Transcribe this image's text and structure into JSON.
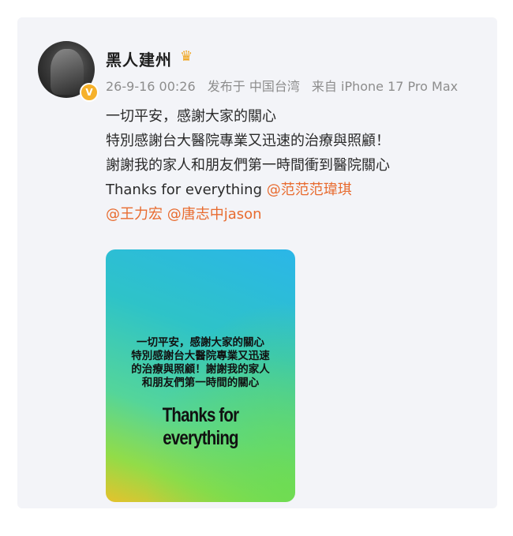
{
  "post": {
    "username": "黑人建州",
    "badge_icon": "crown-icon",
    "verified_icon": "verified-badge-icon",
    "time": "26-9-16 00:26",
    "posted_from": "发布于 中国台湾",
    "device": "来自 iPhone 17 Pro Max",
    "lines": {
      "l1": "一切平安，感謝大家的關心",
      "l2": "特別感謝台大醫院專業又迅速的治療與照顧！",
      "l3": "謝謝我的家人和朋友們第一時間衝到醫院關心",
      "l4": "Thanks for everything ",
      "mention1": "@范范范瑋琪",
      "mention2": "@王力宏",
      "mention3": "@唐志中jason"
    },
    "image": {
      "line1": "一切平安，感謝大家的關心",
      "line2": "特別感謝台大醫院專業又迅速",
      "line3": "的治療與照顧！謝謝我的家人",
      "line4": "和朋友們第一時間的關心",
      "thanks": "Thanks for everything"
    }
  },
  "colors": {
    "mention": "#e86b2f",
    "meta": "#8d8d8d",
    "card_bg": "#f3f4f8"
  }
}
